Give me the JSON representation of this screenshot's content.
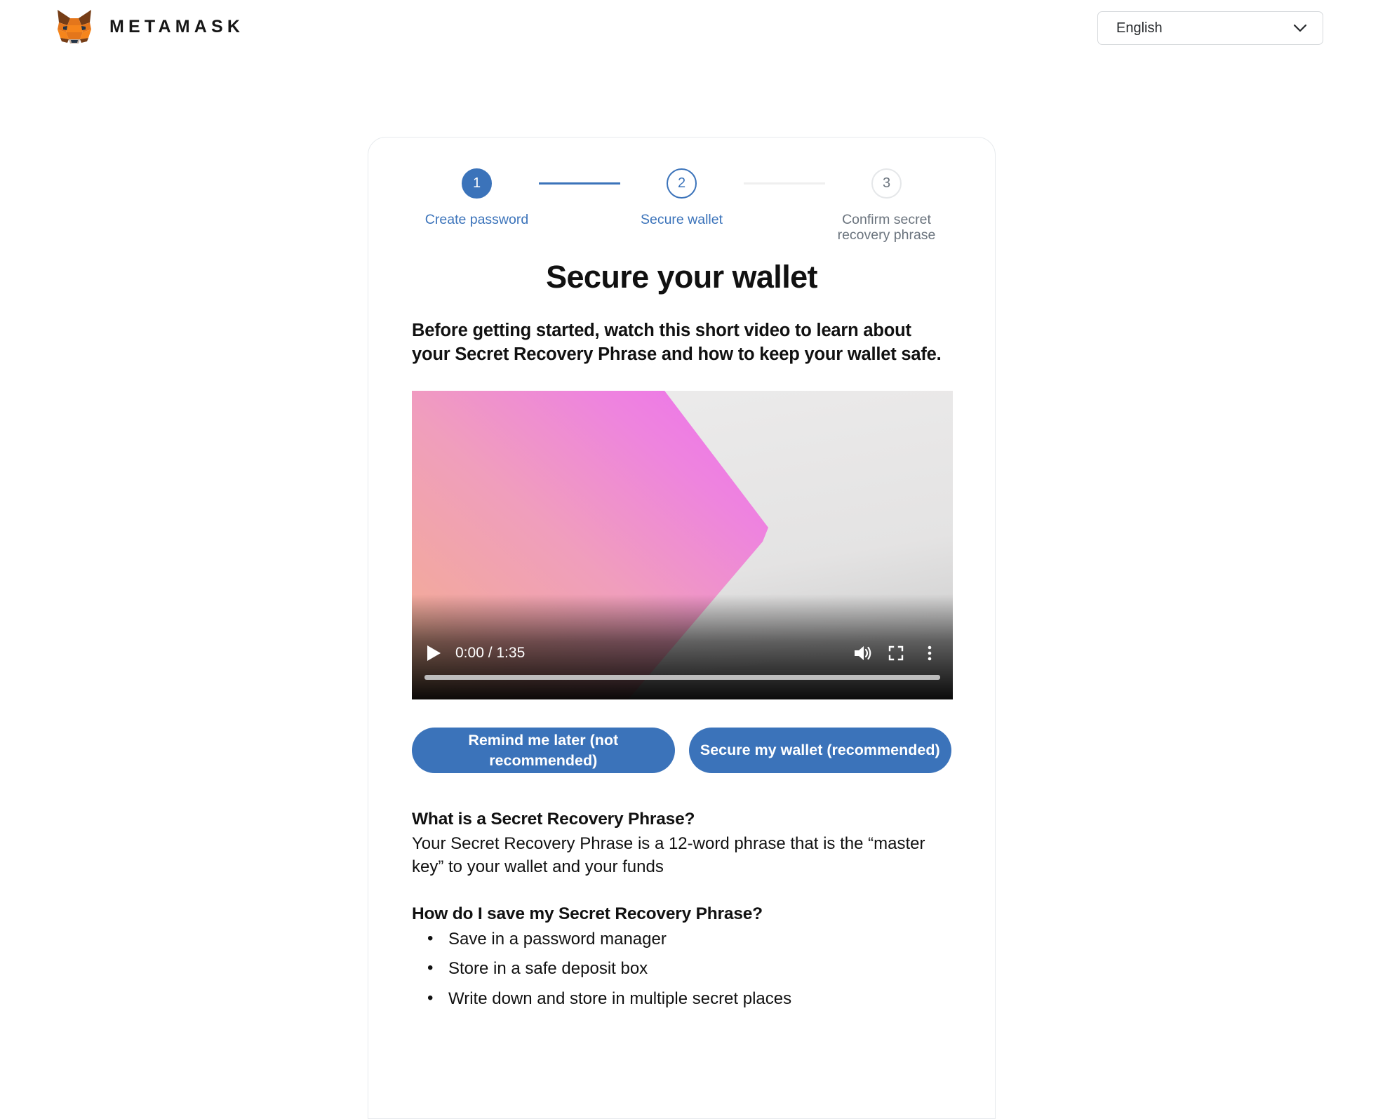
{
  "header": {
    "brand_name": "METAMASK",
    "logo_icon": "metamask-fox-icon",
    "language": {
      "selected": "English",
      "chevron_icon": "chevron-down-icon"
    }
  },
  "stepper": {
    "steps": [
      {
        "number": "1",
        "label": "Create password",
        "state": "done"
      },
      {
        "number": "2",
        "label": "Secure wallet",
        "state": "active"
      },
      {
        "number": "3",
        "label": "Confirm secret\nrecovery phrase",
        "state": "todo"
      }
    ]
  },
  "main": {
    "title": "Secure your wallet",
    "subtitle": "Before getting started, watch this short video to learn about your Secret Recovery Phrase and how to keep your wallet safe."
  },
  "video": {
    "play_icon": "play-icon",
    "current_time": "0:00",
    "duration": "1:35",
    "time_display": "0:00 / 1:35",
    "progress_percent": 0,
    "volume_icon": "volume-on-icon",
    "fullscreen_icon": "fullscreen-icon",
    "more_options_icon": "kebab-menu-icon"
  },
  "actions": {
    "remind_later": "Remind me later (not recommended)",
    "secure_wallet": "Secure my wallet (recommended)"
  },
  "faq": {
    "q1": "What is a Secret Recovery Phrase?",
    "a1": "Your Secret Recovery Phrase is a 12-word phrase that is the “master key” to your wallet and your funds",
    "q2": "How do I save my Secret Recovery Phrase?",
    "a2_items": [
      "Save in a password manager",
      "Store in a safe deposit box",
      "Write down and store in multiple secret places"
    ]
  },
  "colors": {
    "accent_blue": "#3b73ba",
    "text_primary": "#111111",
    "text_muted": "#6a737d",
    "border": "#e7eaed"
  }
}
